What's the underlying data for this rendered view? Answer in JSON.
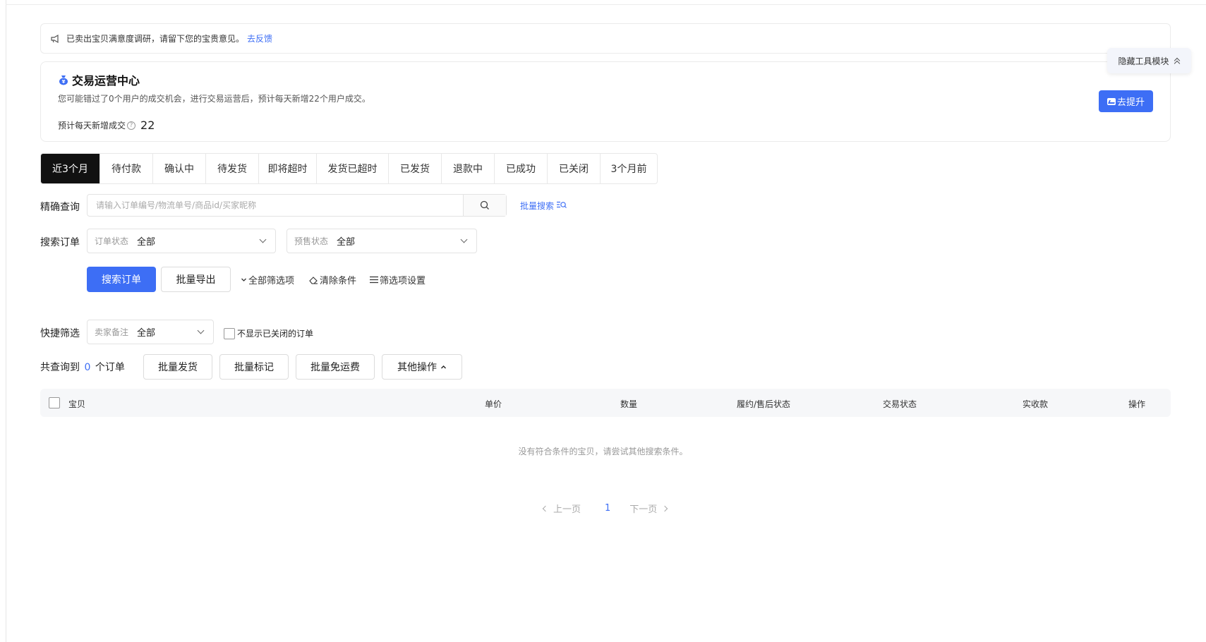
{
  "notice": {
    "text": "已卖出宝贝满意度调研，请留下您的宝贵意见。",
    "link": "去反馈"
  },
  "center": {
    "title": "交易运营中心",
    "desc": "您可能错过了0个用户的成交机会，进行交易运营后，预计每天新增22个用户成交。",
    "pred_label": "预计每天新增成交",
    "pred_value": "22",
    "boost_button": "去提升"
  },
  "hide_tool": "隐藏工具模块",
  "tabs": [
    "近3个月",
    "待付款",
    "确认中",
    "待发货",
    "即将超时",
    "发货已超时",
    "已发货",
    "退款中",
    "已成功",
    "已关闭",
    "3个月前"
  ],
  "precise": {
    "label": "精确查询",
    "placeholder": "请输入订单编号/物流单号/商品id/买家昵称",
    "batch_search": "批量搜索"
  },
  "search_order": {
    "label": "搜索订单",
    "order_status_label": "订单状态",
    "order_status_value": "全部",
    "presale_status_label": "预售状态",
    "presale_status_value": "全部"
  },
  "actions": {
    "search": "搜索订单",
    "export": "批量导出",
    "all_filters": "全部筛选项",
    "clear": "清除条件",
    "filter_settings": "筛选项设置"
  },
  "quick_filter": {
    "label": "快捷筛选",
    "seller_note_label": "卖家备注",
    "seller_note_value": "全部",
    "hide_closed": "不显示已关闭的订单"
  },
  "result": {
    "prefix": "共查询到",
    "count": "0",
    "suffix": "个订单",
    "batch_ship": "批量发货",
    "batch_mark": "批量标记",
    "batch_free_ship": "批量免运费",
    "other": "其他操作"
  },
  "table": {
    "headers": [
      "宝贝",
      "单价",
      "数量",
      "履约/售后状态",
      "交易状态",
      "实收款",
      "操作"
    ],
    "empty": "没有符合条件的宝贝，请尝试其他搜索条件。"
  },
  "pager": {
    "prev": "上一页",
    "current": "1",
    "next": "下一页"
  },
  "colors": {
    "accent": "#3d6ef5",
    "active_tab": "#111111"
  }
}
